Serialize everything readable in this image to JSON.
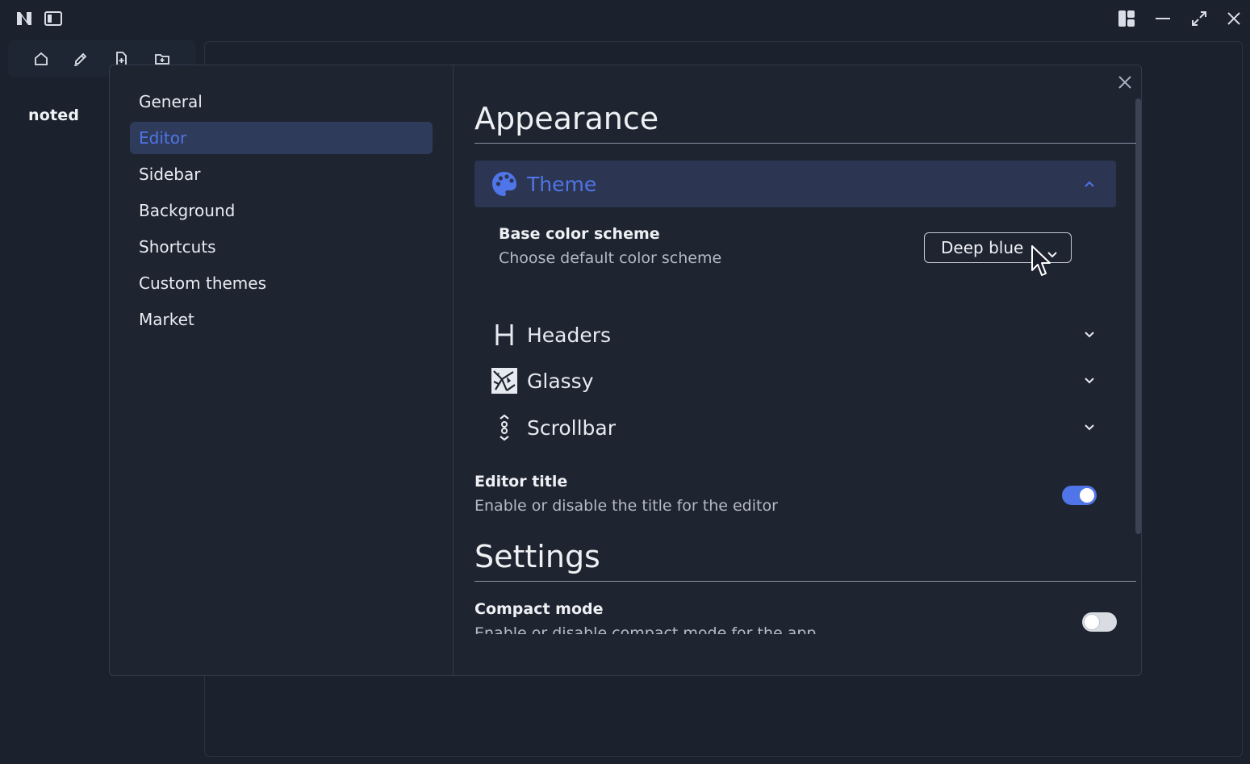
{
  "titlebar": {
    "app_logo": "noted-logo-icon",
    "sidebar_toggle": "sidebar-toggle-icon",
    "window_controls": [
      "layout-icon",
      "minimize-icon",
      "maximize-icon",
      "close-icon"
    ]
  },
  "toolbar": {
    "tools": [
      "home-icon",
      "edit-icon",
      "new-file-icon",
      "new-folder-icon"
    ]
  },
  "sidebar": {
    "brand": "noted"
  },
  "settings": {
    "nav": [
      {
        "label": "General",
        "active": false
      },
      {
        "label": "Editor",
        "active": true
      },
      {
        "label": "Sidebar",
        "active": false
      },
      {
        "label": "Background",
        "active": false
      },
      {
        "label": "Shortcuts",
        "active": false
      },
      {
        "label": "Custom themes",
        "active": false
      },
      {
        "label": "Market",
        "active": false
      }
    ],
    "appearance": {
      "title": "Appearance",
      "theme": {
        "label": "Theme",
        "icon": "palette-icon",
        "expanded": true,
        "base_color_scheme": {
          "title": "Base color scheme",
          "description": "Choose default color scheme",
          "value": "Deep blue"
        }
      },
      "sections": [
        {
          "label": "Headers",
          "icon": "heading-icon"
        },
        {
          "label": "Glassy",
          "icon": "glass-icon"
        },
        {
          "label": "Scrollbar",
          "icon": "scroll-icon"
        }
      ],
      "editor_title": {
        "title": "Editor title",
        "description": "Enable or disable the title for the editor",
        "enabled": true
      }
    },
    "settings_section": {
      "title": "Settings",
      "compact_mode": {
        "title": "Compact mode",
        "description": "Enable or disable compact mode for the app",
        "enabled": false
      }
    }
  },
  "colors": {
    "background": "#1b212d",
    "modal": "#1e2430",
    "accent": "#4f75e8",
    "active_nav_bg": "#2f3b5a"
  }
}
